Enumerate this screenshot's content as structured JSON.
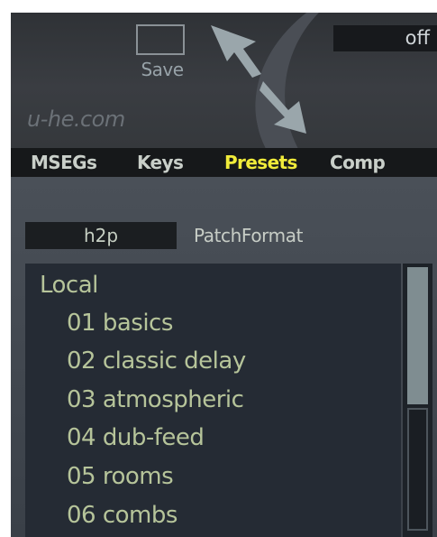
{
  "header": {
    "save_label": "Save",
    "site": "u-he.com",
    "top_field_value": "off"
  },
  "tabs": [
    {
      "label": "MSEGs",
      "active": false
    },
    {
      "label": "Keys",
      "active": false
    },
    {
      "label": "Presets",
      "active": true
    },
    {
      "label": "Comp",
      "active": false
    }
  ],
  "format": {
    "value": "h2p",
    "label": "PatchFormat"
  },
  "preset_list": {
    "items": [
      "Local",
      "01 basics",
      "02 classic delay",
      "03 atmospheric",
      "04 dub-feed",
      "05 rooms",
      "06 combs"
    ]
  },
  "colors": {
    "active_tab": "#f0eb3a",
    "list_text": "#b6c49a",
    "list_background": "#252b34"
  }
}
